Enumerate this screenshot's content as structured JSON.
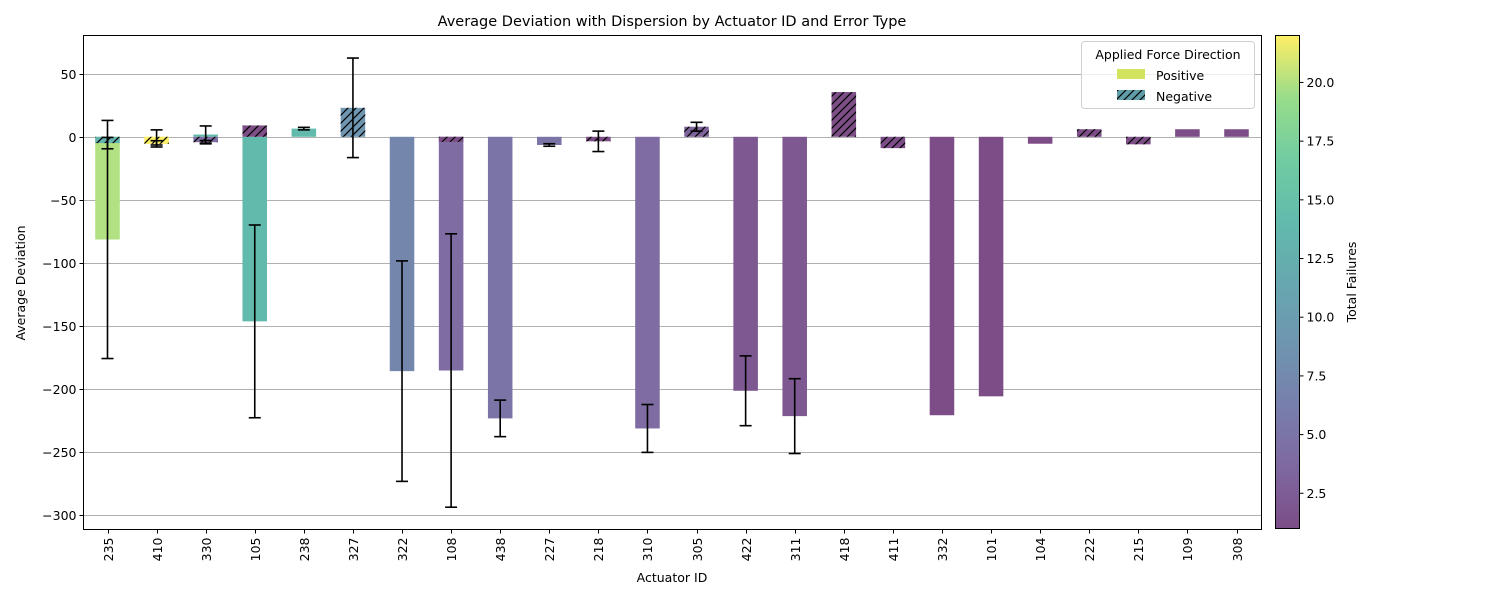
{
  "chart_data": {
    "type": "bar",
    "title": "Average Deviation with Dispersion by Actuator ID and Error Type",
    "xlabel": "Actuator ID",
    "ylabel": "Average Deviation",
    "ylim": [
      -311.7,
      80.4
    ],
    "yticks": [
      50,
      0,
      -50,
      -100,
      -150,
      -200,
      -250,
      -300
    ],
    "ytick_labels": [
      "50",
      "0",
      "−50",
      "−100",
      "−150",
      "−200",
      "−250",
      "−300"
    ],
    "grid": "y",
    "categories": [
      "235",
      "410",
      "330",
      "105",
      "238",
      "327",
      "322",
      "108",
      "438",
      "227",
      "218",
      "310",
      "305",
      "422",
      "311",
      "418",
      "411",
      "332",
      "101",
      "104",
      "222",
      "215",
      "109",
      "308"
    ],
    "legend": {
      "title": "Applied Force Direction",
      "placement": "top-right",
      "entries": [
        {
          "label": "Positive",
          "style": "solid",
          "swatch_color": "#d2e35f"
        },
        {
          "label": "Negative",
          "style": "hatched",
          "swatch_color": "#5f9ea8"
        }
      ]
    },
    "colorbar": {
      "label": "Total Failures",
      "range": [
        1,
        22
      ],
      "ticks": [
        2.5,
        5.0,
        7.5,
        10.0,
        12.5,
        15.0,
        17.5,
        20.0
      ],
      "tick_labels": [
        "2.5",
        "5.0",
        "7.5",
        "10.0",
        "12.5",
        "15.0",
        "17.5",
        "20.0"
      ],
      "colormap": "viridis",
      "alpha": 0.7
    },
    "series": [
      {
        "name": "Positive",
        "hatched": false,
        "values": [
          -81.5,
          -0.5,
          1.8,
          -146.5,
          6.5,
          null,
          -186,
          -185.5,
          -223.5,
          -6.5,
          null,
          -231.5,
          null,
          -201.6,
          -221.7,
          null,
          null,
          -221,
          -206,
          -5.5,
          null,
          null,
          6,
          6
        ],
        "errors": [
          94.5,
          6,
          6.8,
          76.5,
          1,
          null,
          87.5,
          108.5,
          14.5,
          1,
          null,
          19,
          null,
          27.7,
          29.7,
          null,
          null,
          0,
          0,
          0,
          null,
          null,
          0,
          0
        ],
        "failures": [
          20,
          22,
          14,
          14,
          14,
          null,
          7,
          4,
          5,
          5,
          null,
          4,
          null,
          2,
          2,
          null,
          null,
          1,
          1,
          1,
          null,
          null,
          1,
          1
        ]
      },
      {
        "name": "Negative",
        "hatched": true,
        "values": [
          -5,
          -5.6,
          -4.3,
          9,
          null,
          23,
          null,
          -4,
          null,
          null,
          -3.6,
          null,
          8,
          null,
          null,
          35.5,
          -9,
          null,
          null,
          null,
          6,
          -6,
          null,
          null
        ],
        "errors": [
          4.5,
          2.5,
          1.3,
          0,
          null,
          39.5,
          null,
          0,
          null,
          null,
          8.1,
          null,
          3.5,
          null,
          null,
          0,
          0,
          null,
          null,
          null,
          0,
          0,
          null,
          null
        ],
        "failures": [
          13,
          22,
          4,
          1,
          null,
          9,
          null,
          1,
          null,
          null,
          1,
          null,
          3,
          null,
          null,
          1,
          1,
          null,
          null,
          null,
          1,
          1,
          null,
          null
        ]
      }
    ]
  }
}
